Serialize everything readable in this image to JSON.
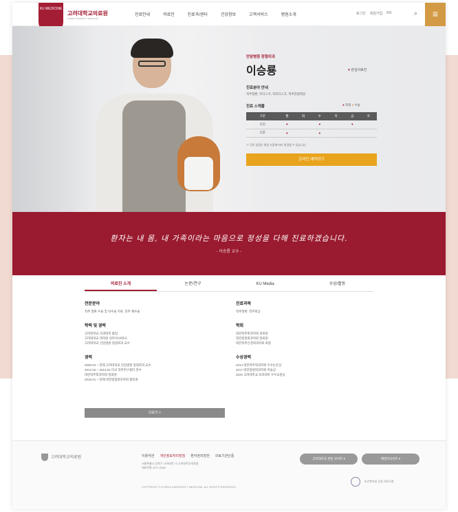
{
  "header": {
    "logo_mark": "KU MEDICINE",
    "logo_title": "고려대학교의료원",
    "logo_sub": "KOREA UNIVERSITY MEDICINE",
    "nav": [
      "진료안내",
      "의료진",
      "진료과/센터",
      "건강정보",
      "고객서비스",
      "병원소개"
    ],
    "util": [
      "로그인",
      "회원가입",
      "EN"
    ],
    "menu_icon": "≡"
  },
  "hero": {
    "dept": "안암병원 정형외과",
    "name": "이승룡",
    "like_label": "관심의료진",
    "field_title": "진료분야 안내",
    "field_text": "척추질환, 목디스크, 허리디스크, 척추관협착증",
    "schedule_title": "진료 스케줄",
    "legend_clinic": "외래",
    "legend_surgery": "수술",
    "schedule_days": [
      "구분",
      "월",
      "화",
      "수",
      "목",
      "금",
      "토"
    ],
    "schedule_rows": [
      {
        "label": "오전",
        "cells": [
          "♥",
          "",
          "♥",
          "",
          "♥",
          ""
        ]
      },
      {
        "label": "오후",
        "cells": [
          "♥",
          "",
          "♥",
          "",
          "",
          ""
        ]
      }
    ],
    "note": "※ 진료 일정은 병원 사정에 따라 변경될 수 있습니다.",
    "reserve_label": "온라인 예약하기"
  },
  "quote": {
    "text": "환자는 내 몸, 내 가족이라는 마음으로 정성을 다해 진료하겠습니다.",
    "author": "- 이승룡 교수 -"
  },
  "tabs": [
    "의료진 소개",
    "논문/연구",
    "KU Media",
    "수상/활동"
  ],
  "profile": {
    "left": [
      {
        "title": "전문분야",
        "body": [
          "척추 질환 수술 및 비수술 치료, 척추 재수술"
        ]
      },
      {
        "title": "학력 및 경력",
        "body": [
          "고려대학교 의과대학 졸업",
          "고려대학교 대학원 의학석사/박사",
          "고려대학교 안암병원 정형외과 교수"
        ]
      },
      {
        "title": "경력",
        "body": [
          "2008.03 ~ 현재 고려대학교 안암병원 정형외과 교수",
          "2012.03 ~ 2013.02 미국 척추연구센터 연수",
          "대한척추외과학회 정회원",
          "2015.01 ~ 현재 대한정형외과학회 평의원"
        ]
      }
    ],
    "right": [
      {
        "title": "진료과목",
        "body": [
          "척추질환, 척추외상"
        ]
      },
      {
        "title": "학회",
        "body": [
          "대한척추외과학회 정회원",
          "대한정형외과학회 정회원",
          "대한척추신경외과학회 회원"
        ]
      },
      {
        "title": "수상경력",
        "body": [
          "2014 대한척추외과학회 우수논문상",
          "2017 대한정형외과학회 학술상",
          "2020 고려대학교 의과대학 우수교원상"
        ]
      }
    ],
    "more_label": "더보기 +"
  },
  "footer": {
    "logo_text": "고려대학교의료원",
    "links": [
      "이용약관",
      "개인정보처리방침",
      "환자권리장전",
      "의료기관인증"
    ],
    "highlight_index": 1,
    "address_lines": [
      "서울특별시 성북구 고려대로 73 고려대학교의료원",
      "대표전화 1577-0083"
    ],
    "copyright": "COPYRIGHT © KOREA UNIVERSITY MEDICINE. ALL RIGHTS RESERVED.",
    "select1": "고려대학교 관련 사이트",
    "select2": "패밀리사이트",
    "cert_text": "보건복지부 인증 의료기관"
  }
}
